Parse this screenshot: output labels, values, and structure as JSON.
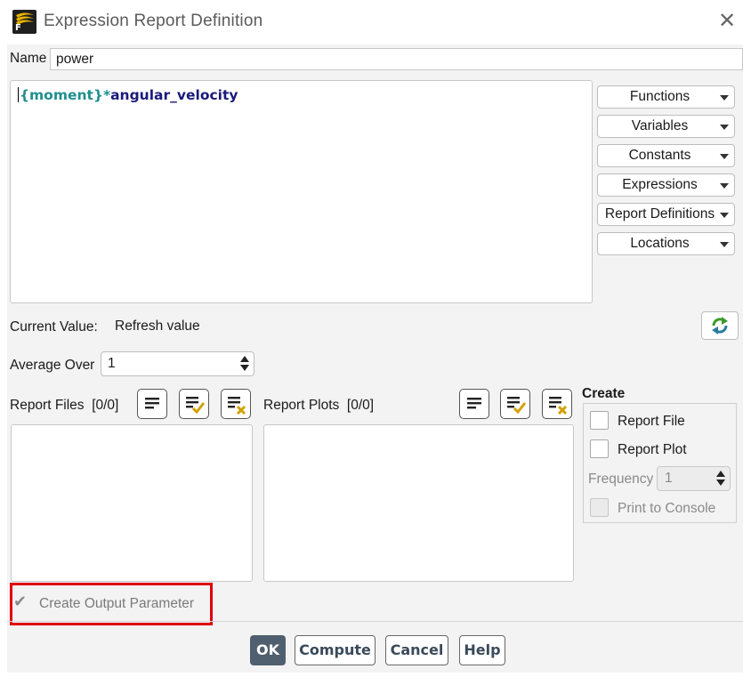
{
  "window": {
    "title": "Expression Report Definition",
    "app_icon_letter": "F"
  },
  "name_field": {
    "label": "Name",
    "value": "power"
  },
  "expression": {
    "part1": "{moment}",
    "operator": "*",
    "part2": "angular_velocity"
  },
  "insert_menus": [
    "Functions",
    "Variables",
    "Constants",
    "Expressions",
    "Report Definitions",
    "Locations"
  ],
  "current_value": {
    "label": "Current Value:",
    "value": "Refresh value"
  },
  "average_over": {
    "label": "Average Over",
    "value": "1"
  },
  "report_files": {
    "label": "Report Files",
    "count": "[0/0]"
  },
  "report_plots": {
    "label": "Report Plots",
    "count": "[0/0]"
  },
  "create": {
    "title": "Create",
    "report_file": "Report File",
    "report_plot": "Report Plot",
    "frequency_label": "Frequency",
    "frequency_value": "1",
    "print_to_console": "Print to Console"
  },
  "output_parameter": {
    "label": "Create Output Parameter",
    "checked": true
  },
  "buttons": {
    "ok": "OK",
    "compute": "Compute",
    "cancel": "Cancel",
    "help": "Help"
  },
  "colors": {
    "expr_teal": "#1f8f8f",
    "expr_navy": "#1a1a7a",
    "highlight_red": "#e0000f",
    "primary_button": "#4f5f6f"
  }
}
